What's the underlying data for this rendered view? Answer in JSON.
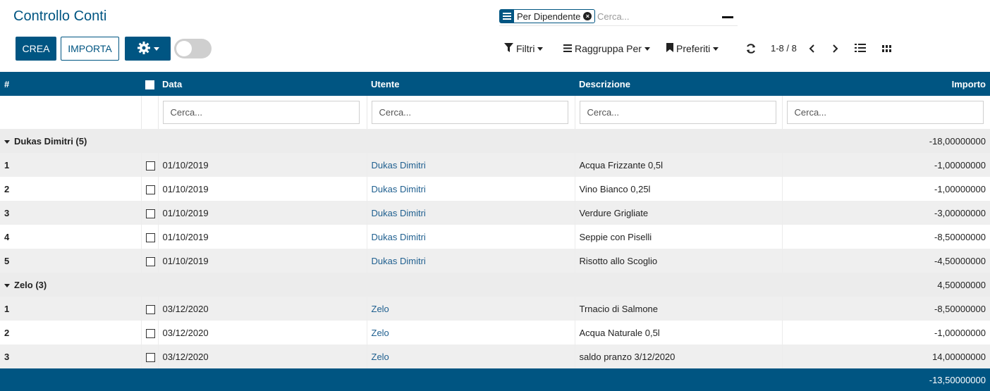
{
  "page": {
    "title": "Controllo Conti"
  },
  "search": {
    "facet_label": "Per Dipendente",
    "placeholder": "Cerca..."
  },
  "buttons": {
    "crea": "CREA",
    "importa": "IMPORTA"
  },
  "toolbar": {
    "filtri": "Filtri",
    "raggruppa": "Raggruppa Per",
    "preferiti": "Preferiti",
    "pager": "1-8 / 8"
  },
  "table": {
    "columns": {
      "num": "#",
      "data": "Data",
      "utente": "Utente",
      "descrizione": "Descrizione",
      "importo": "Importo"
    },
    "filter_placeholder": "Cerca...",
    "groups": [
      {
        "label": "Dukas Dimitri (5)",
        "total": "-18,00000000",
        "rows": [
          {
            "n": "1",
            "date": "01/10/2019",
            "user": "Dukas Dimitri",
            "desc": "Acqua Frizzante 0,5l",
            "amount": "-1,00000000"
          },
          {
            "n": "2",
            "date": "01/10/2019",
            "user": "Dukas Dimitri",
            "desc": "Vino Bianco 0,25l",
            "amount": "-1,00000000"
          },
          {
            "n": "3",
            "date": "01/10/2019",
            "user": "Dukas Dimitri",
            "desc": "Verdure Grigliate",
            "amount": "-3,00000000"
          },
          {
            "n": "4",
            "date": "01/10/2019",
            "user": "Dukas Dimitri",
            "desc": "Seppie con Piselli",
            "amount": "-8,50000000"
          },
          {
            "n": "5",
            "date": "01/10/2019",
            "user": "Dukas Dimitri",
            "desc": "Risotto allo Scoglio",
            "amount": "-4,50000000"
          }
        ]
      },
      {
        "label": "Zelo (3)",
        "total": "4,50000000",
        "rows": [
          {
            "n": "1",
            "date": "03/12/2020",
            "user": "Zelo",
            "desc": "Trnacio di Salmone",
            "amount": "-8,50000000"
          },
          {
            "n": "2",
            "date": "03/12/2020",
            "user": "Zelo",
            "desc": "Acqua Naturale 0,5l",
            "amount": "-1,00000000"
          },
          {
            "n": "3",
            "date": "03/12/2020",
            "user": "Zelo",
            "desc": "saldo pranzo 3/12/2020",
            "amount": "14,00000000"
          }
        ]
      }
    ],
    "grand_total": "-13,50000000"
  },
  "colors": {
    "primary": "#005582",
    "group_bg": "#ececec",
    "row_alt": "#efefef"
  },
  "icons": {
    "facet": "list-icon",
    "facet_remove": "close-circle-icon",
    "gear": "gear-icon",
    "filter": "funnel-icon",
    "group": "list-icon",
    "favorites": "bookmark-icon",
    "refresh": "refresh-icon",
    "prev": "chevron-left-icon",
    "next": "chevron-right-icon",
    "list_view": "list-view-icon",
    "kanban_view": "kanban-view-icon"
  }
}
